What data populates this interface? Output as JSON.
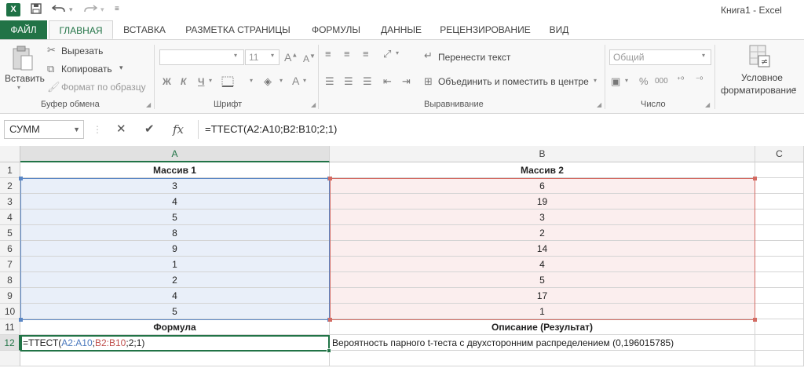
{
  "window": {
    "title": "Книга1 - Excel",
    "qa_save_icon": "save-icon",
    "qa_undo_icon": "undo-icon",
    "qa_redo_icon": "redo-icon",
    "customize_icon": "customize-icon"
  },
  "tabs": {
    "file": "ФАЙЛ",
    "home": "ГЛАВНАЯ",
    "insert": "ВСТАВКА",
    "page_layout": "РАЗМЕТКА СТРАНИЦЫ",
    "formulas": "ФОРМУЛЫ",
    "data": "ДАННЫЕ",
    "review": "РЕЦЕНЗИРОВАНИЕ",
    "view": "ВИД"
  },
  "ribbon": {
    "clipboard": {
      "paste": "Вставить",
      "cut": "Вырезать",
      "copy": "Копировать",
      "format_painter": "Формат по образцу",
      "label": "Буфер обмена"
    },
    "font": {
      "size": "11",
      "bold": "Ж",
      "italic": "К",
      "underline": "Ч",
      "grow": "A",
      "shrink": "A",
      "color": "A",
      "label": "Шрифт"
    },
    "alignment": {
      "wrap": "Перенести текст",
      "merge": "Объединить и поместить в центре",
      "label": "Выравнивание"
    },
    "number": {
      "format": "Общий",
      "percent": "%",
      "thousands": "000",
      "label": "Число"
    },
    "styles": {
      "conditional_1": "Условное",
      "conditional_2": "форматирование"
    }
  },
  "formula_bar": {
    "name_box": "СУММ",
    "cancel": "✕",
    "enter": "✔",
    "fx": "fx",
    "formula": "=ТТЕСТ(A2:A10;B2:B10;2;1)"
  },
  "grid": {
    "columns": [
      "A",
      "B",
      "C"
    ],
    "rows": [
      "1",
      "2",
      "3",
      "4",
      "5",
      "6",
      "7",
      "8",
      "9",
      "10",
      "11",
      "12"
    ],
    "header_a": "Массив 1",
    "header_b": "Массив 2",
    "array1": [
      "3",
      "4",
      "5",
      "8",
      "9",
      "1",
      "2",
      "4",
      "5"
    ],
    "array2": [
      "6",
      "19",
      "3",
      "2",
      "14",
      "4",
      "5",
      "17",
      "1"
    ],
    "formula_label": "Формула",
    "description_label": "Описание (Результат)",
    "edit": {
      "prefix": "=ТТЕСТ(",
      "ref_a": "A2:A10",
      "sep1": ";",
      "ref_b": "B2:B10",
      "suffix": ";2;1)"
    },
    "description": "Вероятность парного t-теста с двухсторонним распределением (0,196015785)"
  }
}
